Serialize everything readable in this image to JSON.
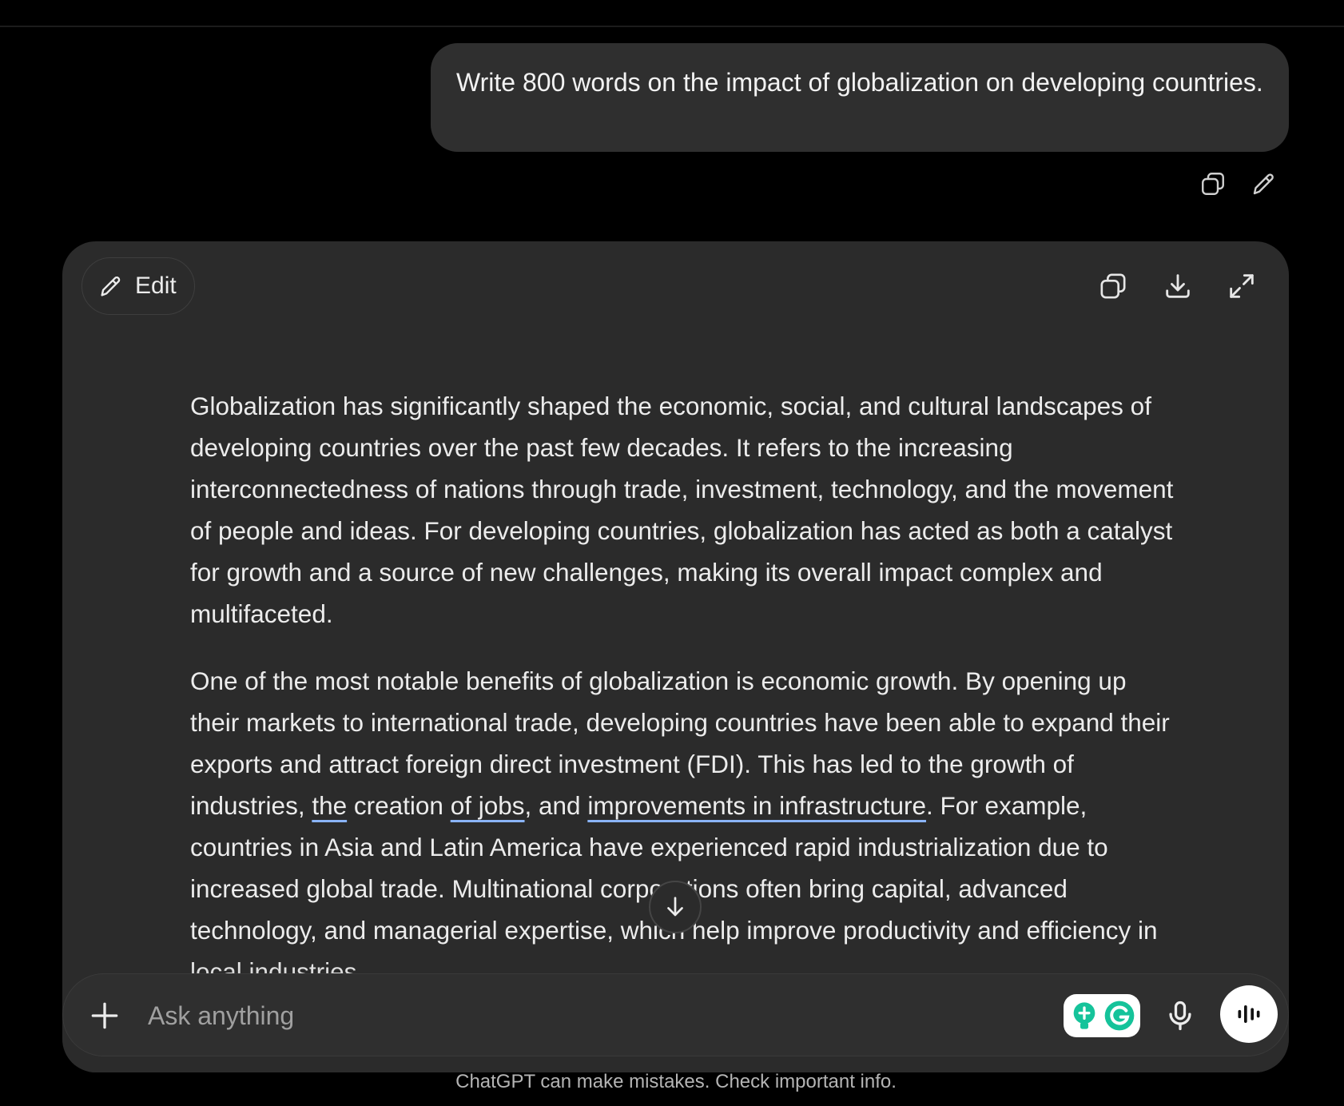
{
  "conversation": {
    "user_message": "Write 800 words on the impact of globalization on developing countries.",
    "user_actions": {
      "copy_icon": "copy-icon",
      "edit_icon": "pencil-icon"
    }
  },
  "canvas": {
    "edit_label": "Edit",
    "tools": {
      "copy": "copy-icon",
      "download": "download-icon",
      "expand": "expand-icon"
    },
    "paragraph1": "Globalization has significantly shaped the economic, social, and cultural landscapes of developing countries over the past few decades. It refers to the increasing interconnectedness of nations through trade, investment, technology, and the movement of people and ideas. For developing countries, globalization has acted as both a catalyst for growth and a source of new challenges, making its overall impact complex and multifaceted.",
    "paragraph2": {
      "part1": "One of the most notable benefits of globalization is economic growth. By opening up their markets to international trade, developing countries have been able to expand their exports and attract foreign direct investment (FDI). This has led to the growth of industries, ",
      "u1": "the",
      "part2": " creation ",
      "u2": "of jobs",
      "part3": ", and ",
      "u3": "improvements in infrastructure",
      "part4": ". For example, countries in Asia and Latin America have experienced rapid industrialization due to increased global trade. Multinational corporations often bring capital, advanced technology, and managerial expertise, which help improve productivity and efficiency in local industries."
    },
    "underline_color": "#8ab4f8"
  },
  "composer": {
    "placeholder": "Ask anything",
    "value": ""
  },
  "footer": {
    "disclaimer": "ChatGPT can make mistakes. Check important info."
  },
  "colors": {
    "background": "#000000",
    "bubble": "#2f2f2f",
    "canvas": "#2b2b2b",
    "grammarly_green": "#15c39a"
  }
}
